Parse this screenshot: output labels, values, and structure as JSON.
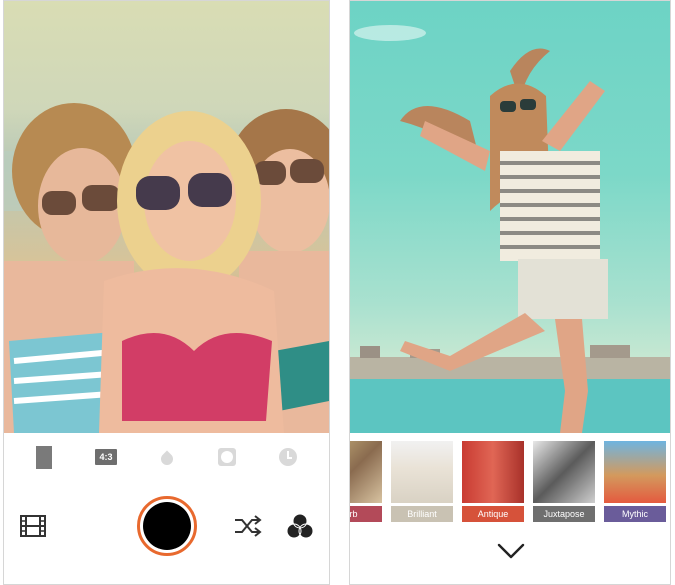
{
  "camera_screen": {
    "toolbar": {
      "aspect_ratio": "4:3",
      "icons": [
        "portrait-frame-icon",
        "aspect-ratio-icon",
        "blur-drop-icon",
        "vignette-icon",
        "timer-icon"
      ]
    },
    "bottom_bar": {
      "icons": [
        "film-strip-icon",
        "shutter-button",
        "shuffle-icon",
        "filters-icon"
      ],
      "shutter_ring_color": "#e8692e"
    }
  },
  "filter_screen": {
    "filters": [
      {
        "label": "erb",
        "color": "#b34a59"
      },
      {
        "label": "Brilliant",
        "color": "#c9c2b3"
      },
      {
        "label": "Antique",
        "color": "#d6523a"
      },
      {
        "label": "Juxtapose",
        "color": "#6f6f6f"
      },
      {
        "label": "Mythic",
        "color": "#6a5c9a"
      }
    ],
    "collapse_icon": "chevron-down-icon"
  }
}
